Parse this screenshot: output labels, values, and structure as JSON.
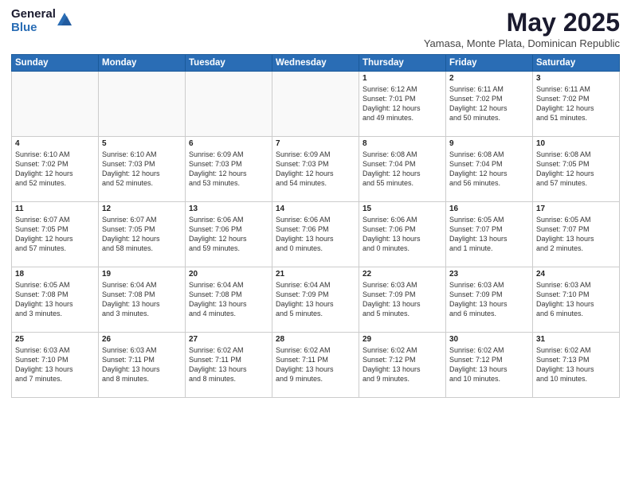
{
  "header": {
    "logo_general": "General",
    "logo_blue": "Blue",
    "month_year": "May 2025",
    "location": "Yamasa, Monte Plata, Dominican Republic"
  },
  "weekdays": [
    "Sunday",
    "Monday",
    "Tuesday",
    "Wednesday",
    "Thursday",
    "Friday",
    "Saturday"
  ],
  "weeks": [
    [
      {
        "day": "",
        "content": ""
      },
      {
        "day": "",
        "content": ""
      },
      {
        "day": "",
        "content": ""
      },
      {
        "day": "",
        "content": ""
      },
      {
        "day": "1",
        "content": "Sunrise: 6:12 AM\nSunset: 7:01 PM\nDaylight: 12 hours\nand 49 minutes."
      },
      {
        "day": "2",
        "content": "Sunrise: 6:11 AM\nSunset: 7:02 PM\nDaylight: 12 hours\nand 50 minutes."
      },
      {
        "day": "3",
        "content": "Sunrise: 6:11 AM\nSunset: 7:02 PM\nDaylight: 12 hours\nand 51 minutes."
      }
    ],
    [
      {
        "day": "4",
        "content": "Sunrise: 6:10 AM\nSunset: 7:02 PM\nDaylight: 12 hours\nand 52 minutes."
      },
      {
        "day": "5",
        "content": "Sunrise: 6:10 AM\nSunset: 7:03 PM\nDaylight: 12 hours\nand 52 minutes."
      },
      {
        "day": "6",
        "content": "Sunrise: 6:09 AM\nSunset: 7:03 PM\nDaylight: 12 hours\nand 53 minutes."
      },
      {
        "day": "7",
        "content": "Sunrise: 6:09 AM\nSunset: 7:03 PM\nDaylight: 12 hours\nand 54 minutes."
      },
      {
        "day": "8",
        "content": "Sunrise: 6:08 AM\nSunset: 7:04 PM\nDaylight: 12 hours\nand 55 minutes."
      },
      {
        "day": "9",
        "content": "Sunrise: 6:08 AM\nSunset: 7:04 PM\nDaylight: 12 hours\nand 56 minutes."
      },
      {
        "day": "10",
        "content": "Sunrise: 6:08 AM\nSunset: 7:05 PM\nDaylight: 12 hours\nand 57 minutes."
      }
    ],
    [
      {
        "day": "11",
        "content": "Sunrise: 6:07 AM\nSunset: 7:05 PM\nDaylight: 12 hours\nand 57 minutes."
      },
      {
        "day": "12",
        "content": "Sunrise: 6:07 AM\nSunset: 7:05 PM\nDaylight: 12 hours\nand 58 minutes."
      },
      {
        "day": "13",
        "content": "Sunrise: 6:06 AM\nSunset: 7:06 PM\nDaylight: 12 hours\nand 59 minutes."
      },
      {
        "day": "14",
        "content": "Sunrise: 6:06 AM\nSunset: 7:06 PM\nDaylight: 13 hours\nand 0 minutes."
      },
      {
        "day": "15",
        "content": "Sunrise: 6:06 AM\nSunset: 7:06 PM\nDaylight: 13 hours\nand 0 minutes."
      },
      {
        "day": "16",
        "content": "Sunrise: 6:05 AM\nSunset: 7:07 PM\nDaylight: 13 hours\nand 1 minute."
      },
      {
        "day": "17",
        "content": "Sunrise: 6:05 AM\nSunset: 7:07 PM\nDaylight: 13 hours\nand 2 minutes."
      }
    ],
    [
      {
        "day": "18",
        "content": "Sunrise: 6:05 AM\nSunset: 7:08 PM\nDaylight: 13 hours\nand 3 minutes."
      },
      {
        "day": "19",
        "content": "Sunrise: 6:04 AM\nSunset: 7:08 PM\nDaylight: 13 hours\nand 3 minutes."
      },
      {
        "day": "20",
        "content": "Sunrise: 6:04 AM\nSunset: 7:08 PM\nDaylight: 13 hours\nand 4 minutes."
      },
      {
        "day": "21",
        "content": "Sunrise: 6:04 AM\nSunset: 7:09 PM\nDaylight: 13 hours\nand 5 minutes."
      },
      {
        "day": "22",
        "content": "Sunrise: 6:03 AM\nSunset: 7:09 PM\nDaylight: 13 hours\nand 5 minutes."
      },
      {
        "day": "23",
        "content": "Sunrise: 6:03 AM\nSunset: 7:09 PM\nDaylight: 13 hours\nand 6 minutes."
      },
      {
        "day": "24",
        "content": "Sunrise: 6:03 AM\nSunset: 7:10 PM\nDaylight: 13 hours\nand 6 minutes."
      }
    ],
    [
      {
        "day": "25",
        "content": "Sunrise: 6:03 AM\nSunset: 7:10 PM\nDaylight: 13 hours\nand 7 minutes."
      },
      {
        "day": "26",
        "content": "Sunrise: 6:03 AM\nSunset: 7:11 PM\nDaylight: 13 hours\nand 8 minutes."
      },
      {
        "day": "27",
        "content": "Sunrise: 6:02 AM\nSunset: 7:11 PM\nDaylight: 13 hours\nand 8 minutes."
      },
      {
        "day": "28",
        "content": "Sunrise: 6:02 AM\nSunset: 7:11 PM\nDaylight: 13 hours\nand 9 minutes."
      },
      {
        "day": "29",
        "content": "Sunrise: 6:02 AM\nSunset: 7:12 PM\nDaylight: 13 hours\nand 9 minutes."
      },
      {
        "day": "30",
        "content": "Sunrise: 6:02 AM\nSunset: 7:12 PM\nDaylight: 13 hours\nand 10 minutes."
      },
      {
        "day": "31",
        "content": "Sunrise: 6:02 AM\nSunset: 7:13 PM\nDaylight: 13 hours\nand 10 minutes."
      }
    ]
  ]
}
